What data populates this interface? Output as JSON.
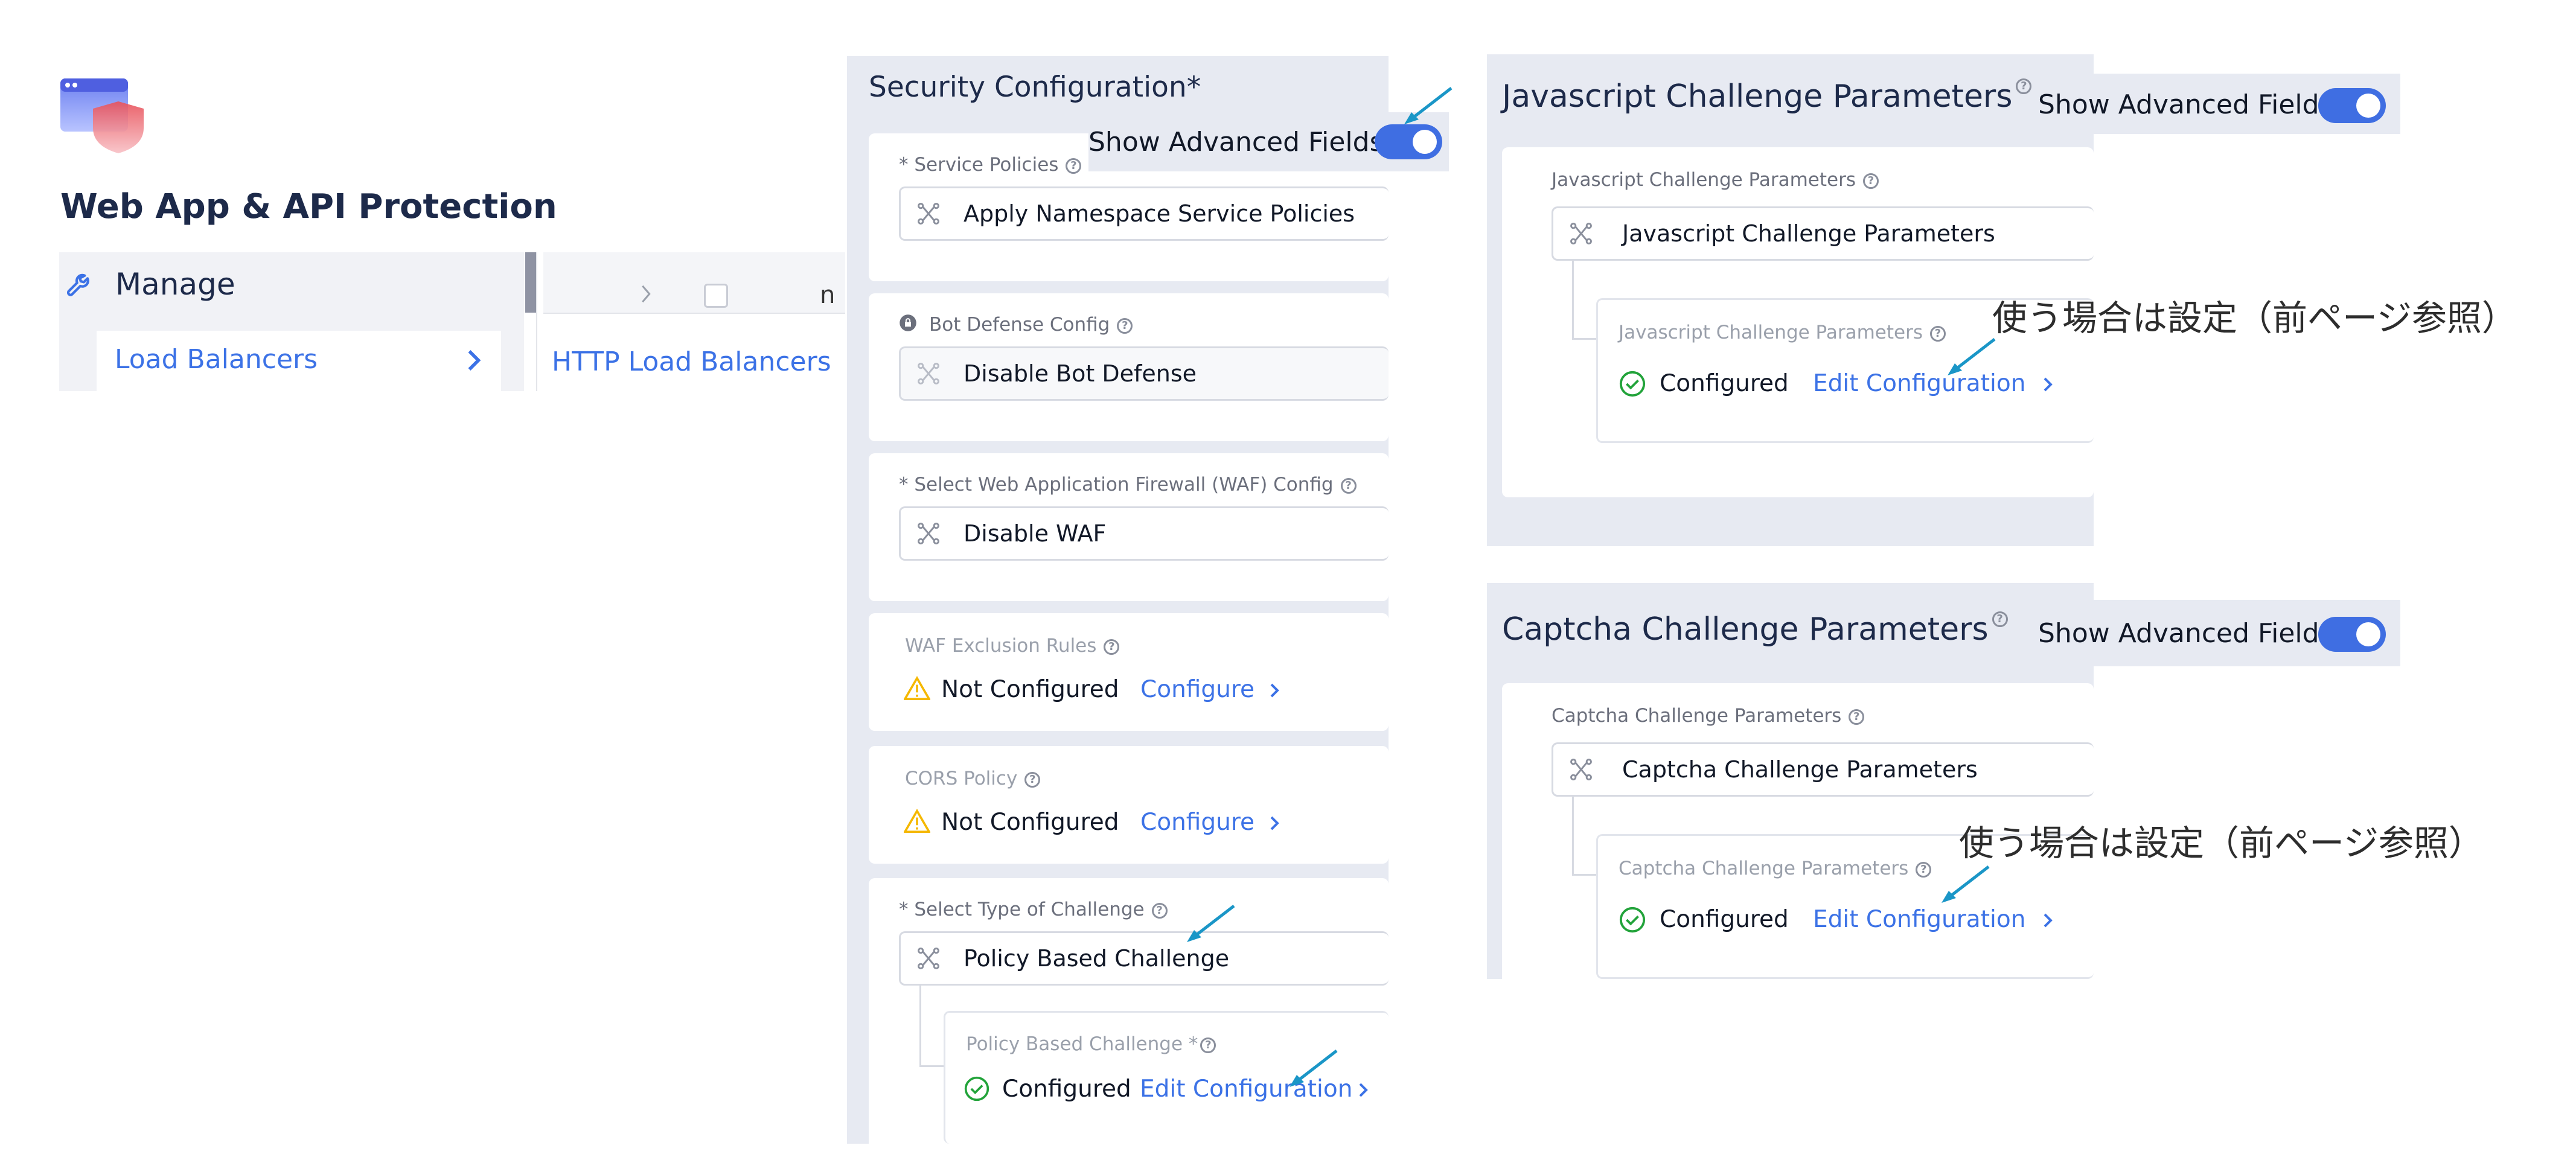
{
  "app": {
    "title": "Web App & API Protection",
    "menu_manage": "Manage",
    "menu_load_balancers": "Load Balancers",
    "submenu_http_lb": "HTTP Load Balancers",
    "truncated_col_text": "n"
  },
  "security": {
    "title": "Security Configuration",
    "required_mark": "*",
    "show_advanced": "Show Advanced Fields",
    "service_policies": {
      "label": "* Service Policies",
      "value": "Apply Namespace Service Policies"
    },
    "bot_defense": {
      "label": "Bot Defense Config",
      "value": "Disable Bot Defense"
    },
    "waf": {
      "label": "* Select Web Application Firewall (WAF) Config",
      "value": "Disable WAF"
    },
    "waf_exclusion": {
      "label": "WAF Exclusion Rules",
      "status": "Not Configured",
      "action": "Configure"
    },
    "cors": {
      "label": "CORS Policy",
      "status": "Not Configured",
      "action": "Configure"
    },
    "challenge_type": {
      "label": "* Select Type of Challenge",
      "value": "Policy Based Challenge"
    },
    "policy_challenge": {
      "label": "Policy Based Challenge *",
      "status": "Configured",
      "action": "Edit Configuration"
    }
  },
  "js_challenge": {
    "title": "Javascript Challenge Parameters",
    "show_advanced": "Show Advanced Fields",
    "field_label": "Javascript Challenge Parameters",
    "value": "Javascript Challenge Parameters",
    "sub_label": "Javascript Challenge Parameters",
    "status": "Configured",
    "action": "Edit Configuration",
    "annotation": "使う場合は設定（前ページ参照）"
  },
  "captcha": {
    "title": "Captcha Challenge Parameters",
    "show_advanced": "Show Advanced Fields",
    "field_label": "Captcha Challenge Parameters",
    "value": "Captcha Challenge Parameters",
    "sub_label": "Captcha Challenge Parameters",
    "status": "Configured",
    "action": "Edit Configuration",
    "annotation": "使う場合は設定（前ページ参照）"
  },
  "icons": {
    "app_logo": "waap-shield-logo",
    "manage": "wrench-icon",
    "select": "route-nodes-icon",
    "bot_lock": "lock-icon",
    "warning": "warning-triangle-icon",
    "check": "check-circle-icon",
    "help": "question-circle-icon",
    "annotation_arrow": "arrow-pointer-icon"
  },
  "colors": {
    "accent": "#3c72e6",
    "toggle": "#3f6ee2",
    "panel": "#e7eaf2",
    "warning": "#f5b800",
    "success": "#22a33a",
    "arrow": "#1a96c7"
  }
}
